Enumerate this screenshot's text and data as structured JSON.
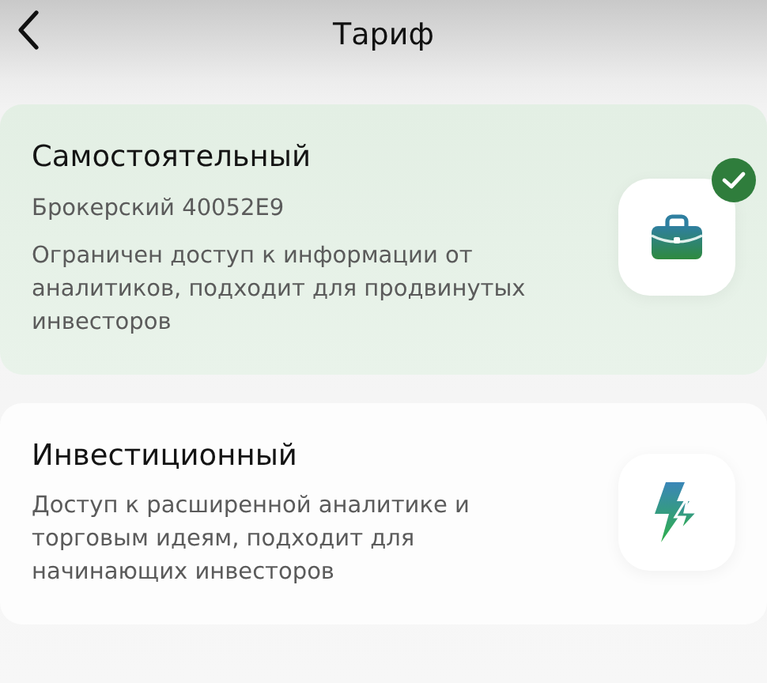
{
  "header": {
    "title": "Тариф"
  },
  "tariffs": [
    {
      "name": "Самостоятельный",
      "subtitle": "Брокерский 40052E9",
      "description": "Ограничен доступ к информации от аналитиков, подходит для продвинутых инвесторов",
      "kind": "briefcase",
      "selected": true
    },
    {
      "name": "Инвестиционный",
      "description": "Доступ к расширенной аналитике и торговым идеям, подходит для начинающих инвесторов",
      "kind": "lightning",
      "selected": false
    }
  ]
}
